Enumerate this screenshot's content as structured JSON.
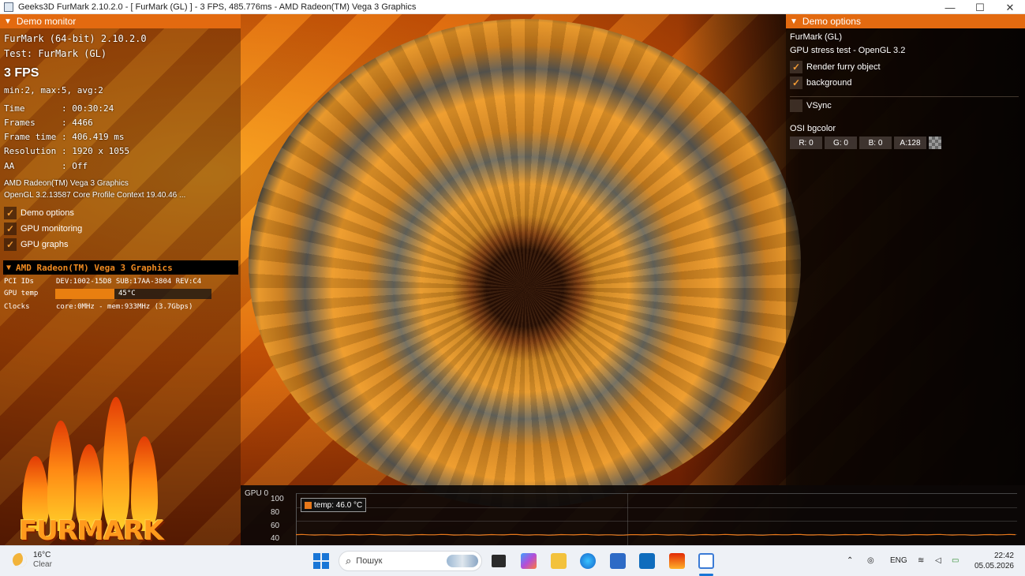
{
  "window": {
    "title": "Geeks3D FurMark 2.10.2.0 - [ FurMark (GL) ] - 3 FPS, 485.776ms - AMD Radeon(TM) Vega 3 Graphics",
    "minimize": "—",
    "maximize": "☐",
    "close": "✕"
  },
  "demo_monitor": {
    "header": "Demo monitor",
    "app_line": "FurMark (64-bit) 2.10.2.0",
    "test_line": "Test: FurMark (GL)",
    "fps": "3 FPS",
    "fps_stats": "min:2, max:5, avg:2",
    "stats": [
      {
        "label": "Time",
        "value": ": 00:30:24"
      },
      {
        "label": "Frames",
        "value": ": 4466"
      },
      {
        "label": "Frame time",
        "value": ": 406.419 ms"
      },
      {
        "label": "Resolution",
        "value": ": 1920 x 1055"
      },
      {
        "label": "AA",
        "value": ": Off"
      }
    ],
    "gpu_name": "AMD Radeon(TM) Vega 3 Graphics",
    "gl_context": "OpenGL 3.2.13587 Core Profile Context 19.40.46 ...",
    "checkboxes": [
      {
        "label": "Demo options",
        "checked": true
      },
      {
        "label": "GPU monitoring",
        "checked": true
      },
      {
        "label": "GPU graphs",
        "checked": true
      }
    ]
  },
  "gpu_monitor": {
    "header": "AMD Radeon(TM) Vega 3 Graphics",
    "pci_label": "PCI IDs",
    "pci_value": "DEV:1002-15D8 SUB:17AA-3804 REV:C4",
    "temp_label": "GPU temp",
    "temp_value": "45°C",
    "temp_fraction": 0.38,
    "clocks_label": "Clocks",
    "clocks_value": "core:0MHz - mem:933MHz (3.7Gbps)",
    "accent": "#e97f10"
  },
  "logo": {
    "text": "FURMARK"
  },
  "demo_options": {
    "header": "Demo options",
    "line1": "FurMark (GL)",
    "line2": "GPU stress test - OpenGL 3.2",
    "checkboxes": [
      {
        "label": "Render furry object",
        "checked": true
      },
      {
        "label": "background",
        "checked": true
      },
      {
        "label": "VSync",
        "checked": false
      }
    ],
    "bgcolor_label": "OSI bgcolor",
    "rgba": [
      "R: 0",
      "G: 0",
      "B: 0",
      "A:128"
    ]
  },
  "graph": {
    "label": "GPU 0",
    "ticks": [
      "100",
      "80",
      "60",
      "40"
    ],
    "legend": "temp: 46.0 °C",
    "series_color": "#e8781a",
    "temp_level": 46
  },
  "taskbar": {
    "weather_temp": "16°C",
    "weather_text": "Clear",
    "search_placeholder": "Пошук",
    "lang": "ENG",
    "time": "22:42",
    "date": "05.05.2026"
  }
}
